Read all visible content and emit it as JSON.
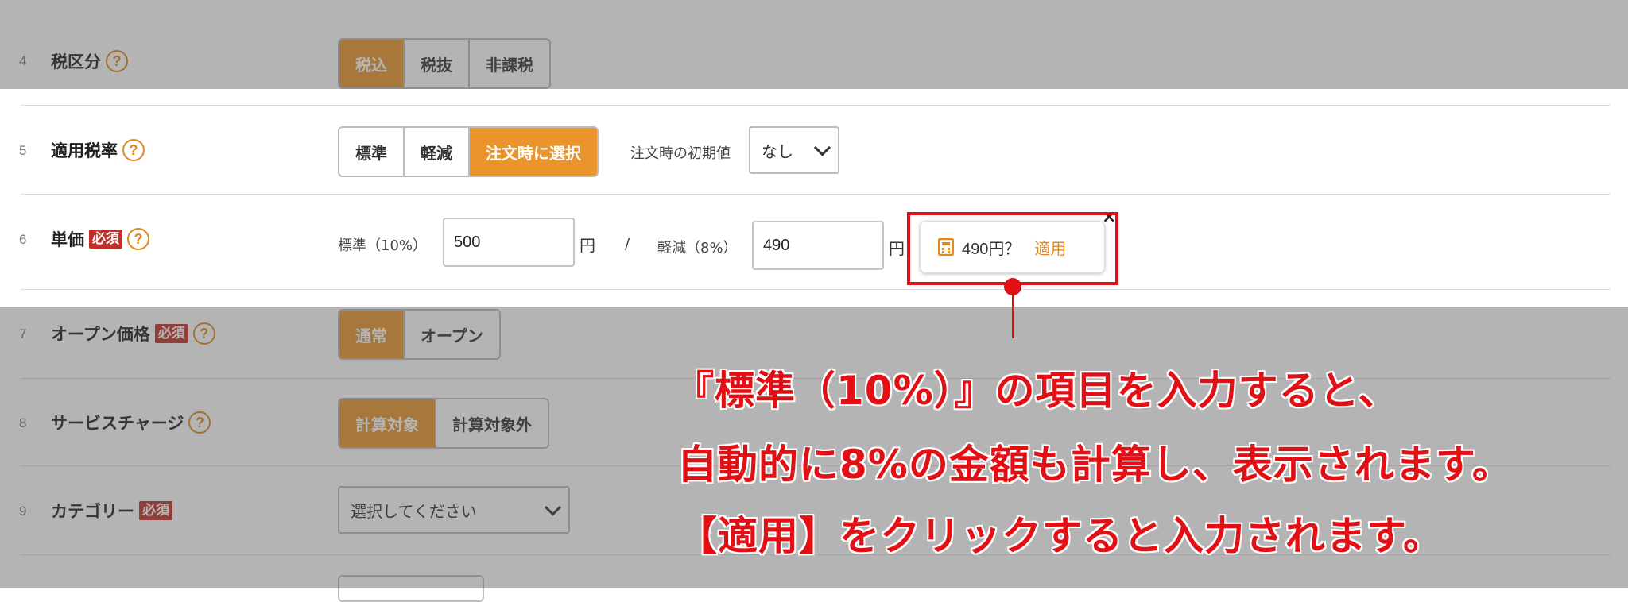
{
  "rows": [
    {
      "num": "4",
      "label": "税区分",
      "options": [
        "税込",
        "税抜",
        "非課税"
      ]
    },
    {
      "num": "5",
      "label": "適用税率",
      "options": [
        "標準",
        "軽減",
        "注文時に選択"
      ],
      "initial_label": "注文時の初期値",
      "initial_value": "なし"
    },
    {
      "num": "6",
      "label": "単価",
      "required": "必須",
      "standard_label": "標準（10%）",
      "standard_value": "500",
      "unit": "円",
      "separator": "/",
      "reduced_label": "軽減（8%）",
      "reduced_value": "490"
    },
    {
      "num": "7",
      "label": "オープン価格",
      "required": "必須",
      "options": [
        "通常",
        "オープン"
      ]
    },
    {
      "num": "8",
      "label": "サービスチャージ",
      "options": [
        "計算対象",
        "計算対象外"
      ]
    },
    {
      "num": "9",
      "label": "カテゴリー",
      "required": "必須",
      "select_value": "選択してください"
    }
  ],
  "help_glyph": "?",
  "popup": {
    "text": "490円？",
    "apply": "適用",
    "close": "×",
    "icon": "calculator-icon"
  },
  "annotation": {
    "line1": "『標準（10%）』の項目を入力すると、",
    "line2": "自動的に8%の金額も計算し、表示されます。",
    "line3": "【適用】をクリックすると入力されます。"
  },
  "colors": {
    "accent": "#e9952c",
    "required": "#c0302a",
    "annotation": "#e20f14"
  }
}
